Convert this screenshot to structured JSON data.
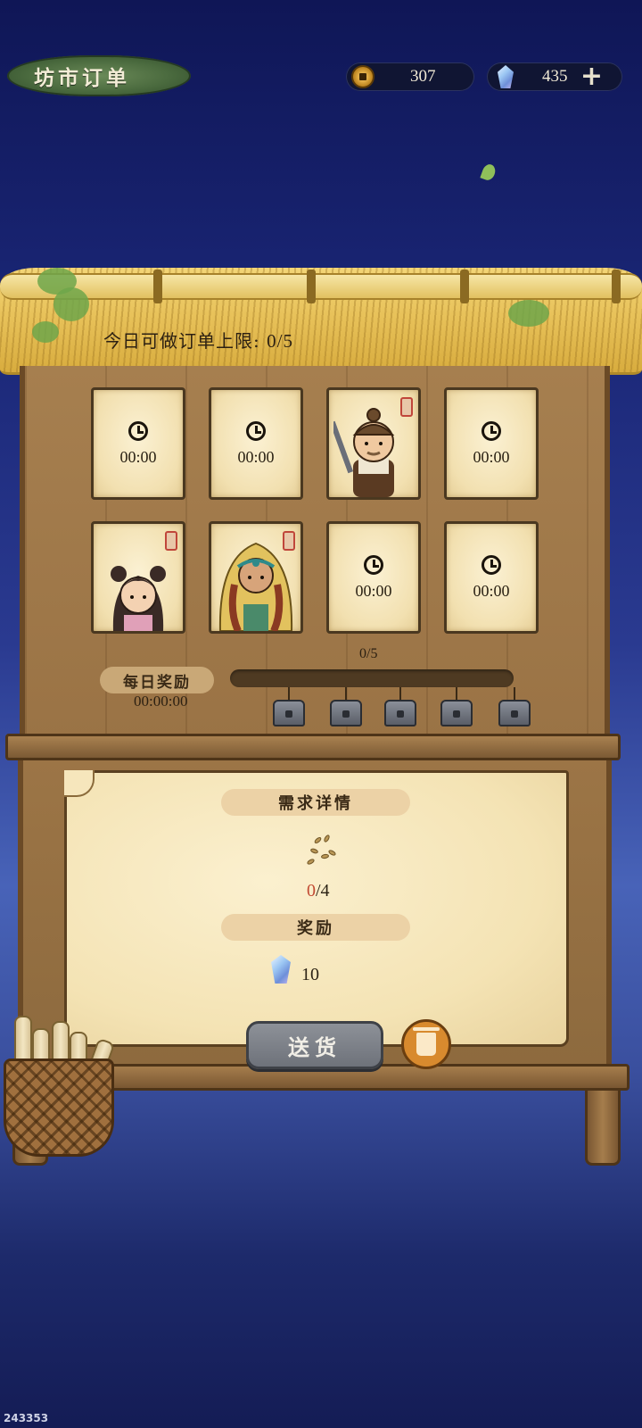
{
  "header": {
    "title": "坊市订单",
    "coins": "307",
    "gems": "435"
  },
  "booth": {
    "daily_limit_label": "今日可做订单上限:",
    "daily_limit_value": "0/5"
  },
  "order_slots": [
    {
      "state": "timer",
      "time": "00:00"
    },
    {
      "state": "timer",
      "time": "00:00"
    },
    {
      "state": "customer",
      "portrait": "old-man-portrait"
    },
    {
      "state": "timer",
      "time": "00:00"
    },
    {
      "state": "customer",
      "portrait": "girl-portrait"
    },
    {
      "state": "customer",
      "portrait": "veiled-woman-portrait"
    },
    {
      "state": "timer",
      "time": "00:00"
    },
    {
      "state": "timer",
      "time": "00:00"
    }
  ],
  "daily_reward": {
    "label": "每日奖励",
    "timer": "00:00:00",
    "progress_text": "0/5",
    "progress_fraction": 0,
    "chests": 5
  },
  "details": {
    "requirement_label": "需求详情",
    "item_icon": "seeds-icon",
    "have": "0",
    "need": "/4",
    "reward_label": "奖励",
    "reward_icon": "gem-icon",
    "reward_amount": "10"
  },
  "actions": {
    "deliver_label": "送货",
    "discard_icon": "trash-icon"
  },
  "footer_id": "243353",
  "colors": {
    "paper": "#f4e3b4",
    "wood": "#9a7345",
    "deliver_button": "#7e8289",
    "trash_button": "#d88a2e",
    "have_count": "#c24a32"
  }
}
